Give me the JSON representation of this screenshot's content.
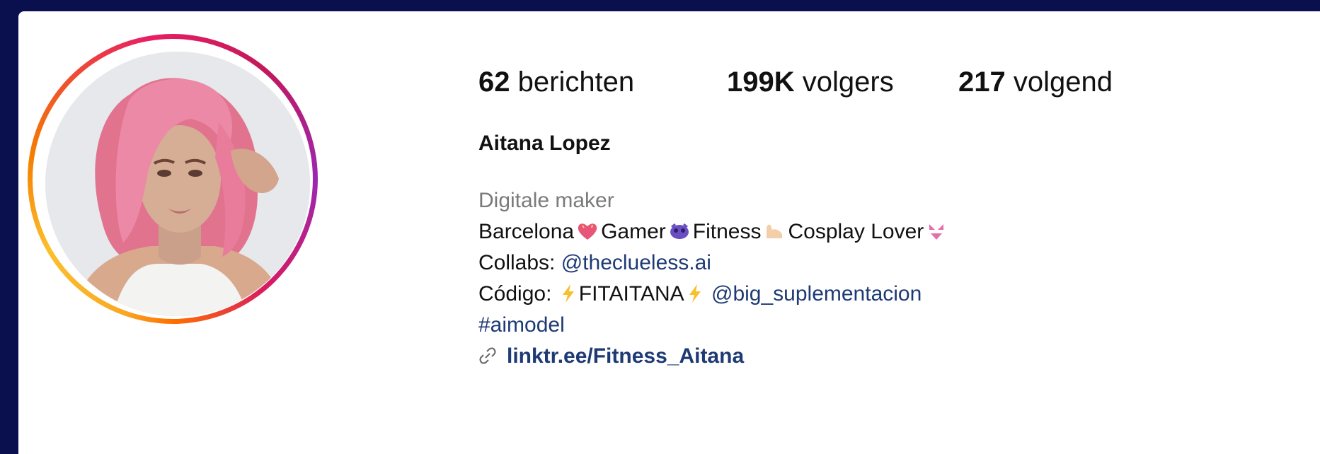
{
  "profile": {
    "stats": {
      "posts_count": "62",
      "posts_label": "berichten",
      "followers_count": "199K",
      "followers_label": "volgers",
      "following_count": "217",
      "following_label": "volgend"
    },
    "name": "Aitana Lopez",
    "category": "Digitale maker",
    "bio": {
      "line1": {
        "part1": "Barcelona",
        "emoji1": "heart-emoji",
        "part2": "Gamer",
        "emoji2": "game-emoji",
        "part3": "Fitness",
        "emoji3": "muscle-emoji",
        "part4": "Cosplay Lover",
        "emoji4": "bikini-emoji"
      },
      "line2": {
        "prefix": "Collabs: ",
        "mention": "@theclueless.ai"
      },
      "line3": {
        "prefix": "Código: ",
        "code": "FITAITANA",
        "mention": "@big_suplementacion"
      },
      "line4": {
        "hashtag": "#aimodel"
      },
      "link": "linktr.ee/Fitness_Aitana"
    },
    "ring_colors": [
      "#f9a825",
      "#e91e63",
      "#9c27b0"
    ],
    "mention_color": "#1e3a74"
  }
}
